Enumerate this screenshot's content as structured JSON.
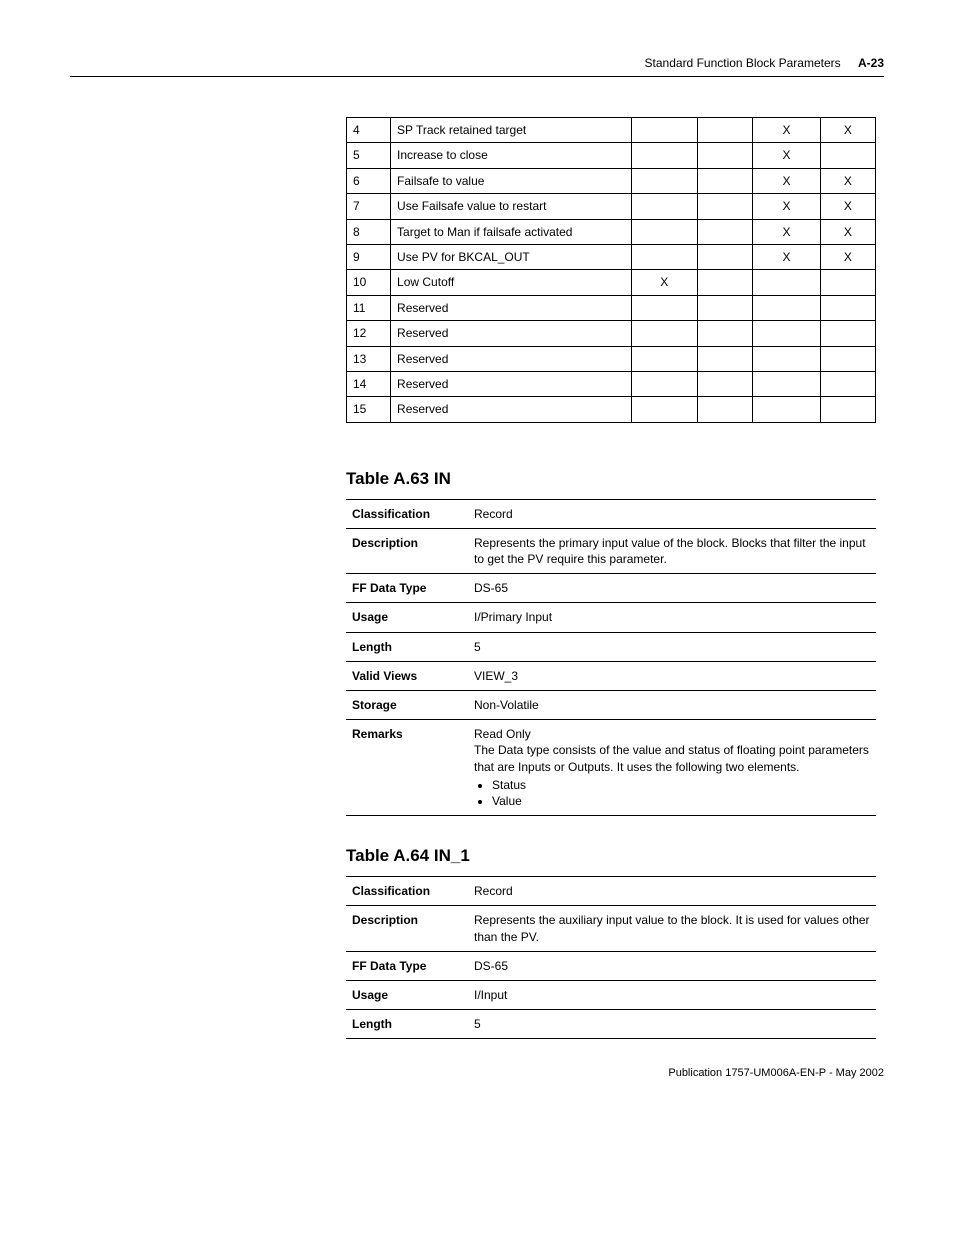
{
  "header": {
    "title": "Standard Function Block Parameters",
    "page_num": "A-23"
  },
  "top_table": {
    "rows": [
      {
        "idx": "4",
        "desc": "SP Track retained target",
        "c3": "",
        "c4": "",
        "c5": "X",
        "c6": "X"
      },
      {
        "idx": "5",
        "desc": "Increase to close",
        "c3": "",
        "c4": "",
        "c5": "X",
        "c6": ""
      },
      {
        "idx": "6",
        "desc": "Failsafe to value",
        "c3": "",
        "c4": "",
        "c5": "X",
        "c6": "X"
      },
      {
        "idx": "7",
        "desc": "Use Failsafe value to restart",
        "c3": "",
        "c4": "",
        "c5": "X",
        "c6": "X"
      },
      {
        "idx": "8",
        "desc": "Target to Man if failsafe activated",
        "c3": "",
        "c4": "",
        "c5": "X",
        "c6": "X"
      },
      {
        "idx": "9",
        "desc": "Use PV for BKCAL_OUT",
        "c3": "",
        "c4": "",
        "c5": "X",
        "c6": "X"
      },
      {
        "idx": "10",
        "desc": "Low Cutoff",
        "c3": "X",
        "c4": "",
        "c5": "",
        "c6": ""
      },
      {
        "idx": "11",
        "desc": "Reserved",
        "c3": "",
        "c4": "",
        "c5": "",
        "c6": ""
      },
      {
        "idx": "12",
        "desc": "Reserved",
        "c3": "",
        "c4": "",
        "c5": "",
        "c6": ""
      },
      {
        "idx": "13",
        "desc": "Reserved",
        "c3": "",
        "c4": "",
        "c5": "",
        "c6": ""
      },
      {
        "idx": "14",
        "desc": "Reserved",
        "c3": "",
        "c4": "",
        "c5": "",
        "c6": ""
      },
      {
        "idx": "15",
        "desc": "Reserved",
        "c3": "",
        "c4": "",
        "c5": "",
        "c6": ""
      }
    ]
  },
  "table_a63": {
    "title": "Table A.63 IN",
    "labels": {
      "classification": "Classification",
      "description": "Description",
      "ff_data_type": "FF Data Type",
      "usage": "Usage",
      "length": "Length",
      "valid_views": "Valid Views",
      "storage": "Storage",
      "remarks": "Remarks"
    },
    "values": {
      "classification": "Record",
      "description": "Represents the primary input value of the block. Blocks that filter the input to get the PV require this parameter.",
      "ff_data_type": "DS-65",
      "usage": "I/Primary Input",
      "length": "5",
      "valid_views": "VIEW_3",
      "storage": "Non-Volatile",
      "remarks_line1": "Read Only",
      "remarks_line2": "The Data type consists of the value and status of floating point parameters that are Inputs or Outputs. It uses the following two elements.",
      "remarks_bullets": [
        "Status",
        "Value"
      ]
    }
  },
  "table_a64": {
    "title": "Table A.64 IN_1",
    "labels": {
      "classification": "Classification",
      "description": "Description",
      "ff_data_type": "FF Data Type",
      "usage": "Usage",
      "length": "Length"
    },
    "values": {
      "classification": "Record",
      "description": "Represents the auxiliary input value to the block. It is used for values other than the PV.",
      "ff_data_type": "DS-65",
      "usage": "I/Input",
      "length": "5"
    }
  },
  "footer": {
    "text": "Publication 1757-UM006A-EN-P - May 2002"
  }
}
